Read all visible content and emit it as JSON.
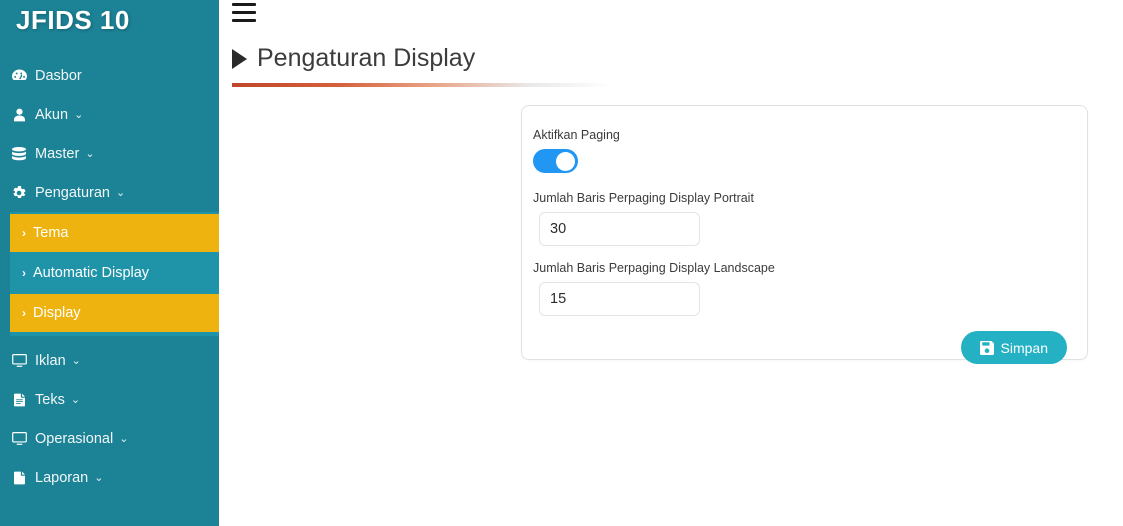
{
  "brand": {
    "title": "JFIDS 10"
  },
  "sidebar": {
    "items": [
      {
        "label": "Dasbor",
        "icon": "dashboard-icon",
        "caret": ""
      },
      {
        "label": "Akun",
        "icon": "user-icon",
        "caret": "⌄"
      },
      {
        "label": "Master",
        "icon": "database-icon",
        "caret": "⌄"
      },
      {
        "label": "Pengaturan",
        "icon": "gear-icon",
        "caret": "⌄"
      },
      {
        "label": "Iklan",
        "icon": "monitor-icon",
        "caret": "⌄"
      },
      {
        "label": "Teks",
        "icon": "file-text-icon",
        "caret": "⌄"
      },
      {
        "label": "Operasional",
        "icon": "monitor-icon",
        "caret": "⌄"
      },
      {
        "label": "Laporan",
        "icon": "file-icon",
        "caret": "⌄"
      }
    ],
    "submenu": [
      {
        "label": "Tema",
        "chevron": "›",
        "state": "highlighted"
      },
      {
        "label": "Automatic Display",
        "chevron": "›",
        "state": "normal"
      },
      {
        "label": "Display",
        "chevron": "›",
        "state": "highlighted"
      }
    ],
    "colors": {
      "background": "#1c8296",
      "submenu_panel": "#1f93a8",
      "highlight": "#efb30f"
    }
  },
  "topbar": {
    "menu_toggle_icon": "hamburger-icon"
  },
  "page": {
    "title": "Pengaturan Display",
    "title_marker_icon": "play-triangle-icon"
  },
  "form": {
    "paging_toggle": {
      "label": "Aktifkan Paging",
      "state": "on"
    },
    "portrait_rows": {
      "label": "Jumlah Baris Perpaging Display Portrait",
      "value": "30"
    },
    "landscape_rows": {
      "label": "Jumlah Baris Perpaging Display Landscape",
      "value": "15"
    },
    "save_button": {
      "label": "Simpan",
      "icon": "floppy-save-icon",
      "color": "#25b1c4"
    }
  }
}
